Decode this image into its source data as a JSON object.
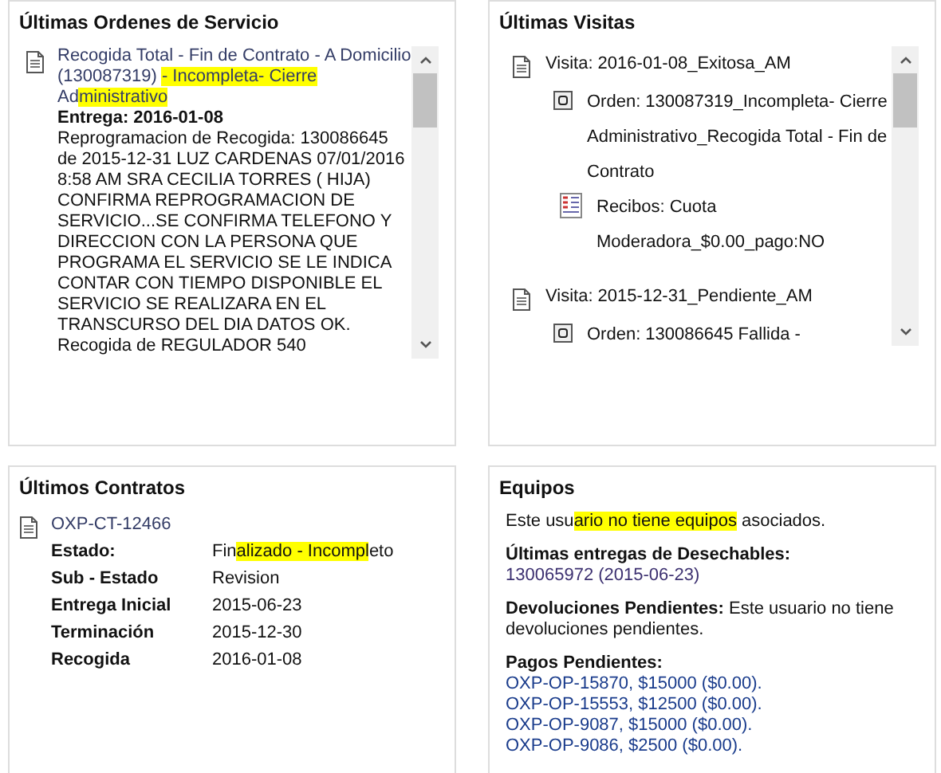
{
  "ordenes": {
    "title": "Últimas Ordenes de Servicio",
    "items": [
      {
        "heading": [
          {
            "text": "Recogida Total - Fin de Contrato - A Domicilio (130087319) ",
            "highlighted": false
          },
          {
            "text": "- Incompleta- Cierre",
            "highlighted": true
          },
          {
            "text": " Ad",
            "highlighted": false
          },
          {
            "text": "ministrativo",
            "highlighted": true
          }
        ],
        "entrega": "Entrega: 2016-01-08",
        "detail": [
          "Reprogramacion de Recogida: 130086645",
          "de 2015-12-31 LUZ CARDENAS 07/01/2016",
          "8:58 AM SRA CECILIA TORRES ( HIJA)",
          "CONFIRMA REPROGRAMACION DE",
          "SERVICIO...SE CONFIRMA TELEFONO Y",
          "DIRECCION CON LA PERSONA QUE",
          "PROGRAMA EL SERVICIO SE LE INDICA",
          "CONTAR CON TIEMPO DISPONIBLE EL",
          "SERVICIO SE REALIZARA EN EL",
          "TRANSCURSO DEL DIA DATOS OK.",
          "Recogida de REGULADOR 540"
        ]
      }
    ]
  },
  "visitas": {
    "title": "Últimas Visitas",
    "items": [
      {
        "label": [
          "Visita: 2016-01-08_Exitosa_AM"
        ],
        "children": [
          {
            "label": [
              "Orden: 130087319_Incompleta- Cierre",
              "Administrativo_Recogida Total - Fin de",
              "Contrato"
            ],
            "children": [
              {
                "label": [
                  "Recibos: Cuota",
                  "Moderadora_$0.00_pago:NO"
                ]
              }
            ]
          }
        ]
      },
      {
        "label": [
          "Visita: 2015-12-31_Pendiente_AM"
        ],
        "children": [
          {
            "label": [
              "Orden: 130086645  Fallida -"
            ]
          }
        ]
      }
    ]
  },
  "contratos": {
    "title": "Últimos Contratos",
    "items": [
      {
        "code": "OXP-CT-12466",
        "fields": [
          {
            "label": "Estado:",
            "value": [
              {
                "text": "Fin",
                "highlighted": false
              },
              {
                "text": "alizado - Incompl",
                "highlighted": true
              },
              {
                "text": "eto",
                "highlighted": false
              }
            ]
          },
          {
            "label": "Sub - Estado",
            "value": [
              {
                "text": "Revision",
                "highlighted": false
              }
            ]
          },
          {
            "label": "Entrega Inicial",
            "value": [
              {
                "text": "2015-06-23",
                "highlighted": false
              }
            ]
          },
          {
            "label": "Terminación",
            "value": [
              {
                "text": "2015-12-30",
                "highlighted": false
              }
            ]
          },
          {
            "label": "Recogida",
            "value": [
              {
                "text": "2016-01-08",
                "highlighted": false
              }
            ]
          }
        ]
      }
    ]
  },
  "equipos": {
    "title": "Equipos",
    "message": [
      {
        "text": "Este usu",
        "highlighted": false
      },
      {
        "text": "ario no tiene equipos",
        "highlighted": true
      },
      {
        "text": " asociados.",
        "highlighted": false
      }
    ],
    "entregas_label": "Últimas entregas de Desechables:",
    "entregas": [
      "130065972 (2015-06-23)"
    ],
    "devoluciones": "**Devoluciones Pendientes:** Este usuario no tiene devoluciones pendientes.",
    "pagos_label": "Pagos Pendientes:",
    "pagos": [
      "OXP-OP-15870, $15000 ($0.00).",
      "OXP-OP-15553, $12500 ($0.00).",
      "OXP-OP-9087, $15000 ($0.00).",
      "OXP-OP-9086, $2500 ($0.00)."
    ]
  }
}
